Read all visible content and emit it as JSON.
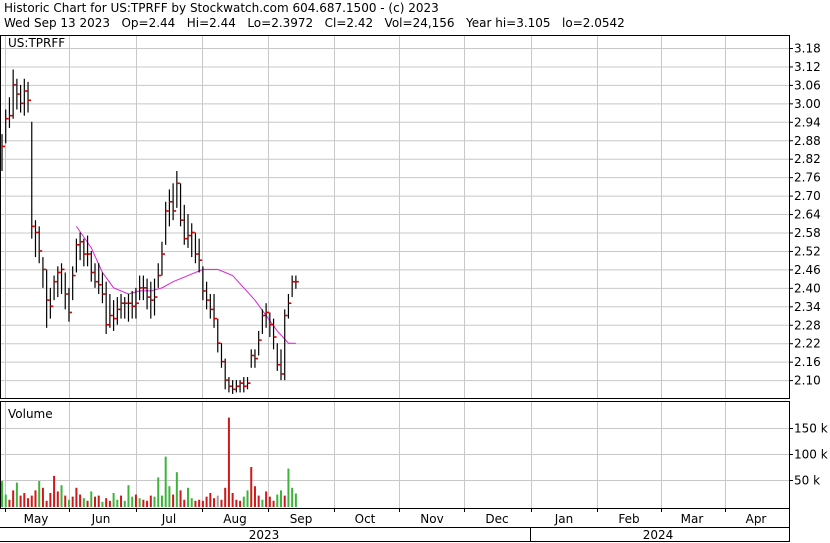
{
  "header": {
    "line1": "Historic Chart for US:TPRFF by Stockwatch.com 604.687.1500 - (c) 2023",
    "line2": "Wed Sep 13 2023   Op=2.44   Hi=2.44   Lo=2.3972   Cl=2.42   Vol=24,156   Year hi=3.105   lo=2.0542"
  },
  "price_panel": {
    "label": "US:TPRFF"
  },
  "volume_panel": {
    "label": "Volume"
  },
  "colors": {
    "grid": "#c8c8c8",
    "bar": "#000000",
    "close_tick": "#d00000",
    "moving_average": "#e020e0",
    "volume_up": "#3cb43c",
    "volume_down": "#d01818",
    "volume_flat": "#a0a0a0"
  },
  "chart_data": [
    {
      "type": "ohlc",
      "symbol": "US:TPRFF",
      "y_ticks": [
        "3.18",
        "3.12",
        "3.06",
        "3.00",
        "2.94",
        "2.88",
        "2.82",
        "2.76",
        "2.70",
        "2.64",
        "2.58",
        "2.52",
        "2.46",
        "2.40",
        "2.34",
        "2.28",
        "2.22",
        "2.16",
        "2.10"
      ],
      "ylim": [
        2.04,
        3.22
      ],
      "x_ticks": [
        "May",
        "Jun",
        "Jul",
        "Aug",
        "Sep",
        "Oct",
        "Nov",
        "Dec",
        "Jan",
        "Feb",
        "Mar",
        "Apr"
      ],
      "year_labels": [
        "2023",
        "2024"
      ],
      "x_range": [
        0,
        291
      ],
      "bars": [
        {
          "x": 0,
          "h": 2.9,
          "l": 2.78,
          "c": 2.86
        },
        {
          "x": 1,
          "h": 2.98,
          "l": 2.87,
          "c": 2.95
        },
        {
          "x": 2,
          "h": 3.02,
          "l": 2.92,
          "c": 2.96
        },
        {
          "x": 3,
          "h": 3.11,
          "l": 2.95,
          "c": 3.06
        },
        {
          "x": 4,
          "h": 3.08,
          "l": 2.98,
          "c": 3.03
        },
        {
          "x": 5,
          "h": 3.06,
          "l": 2.97,
          "c": 3.0
        },
        {
          "x": 6,
          "h": 3.08,
          "l": 2.96,
          "c": 3.04
        },
        {
          "x": 7,
          "h": 3.07,
          "l": 2.97,
          "c": 3.01
        },
        {
          "x": 8,
          "h": 2.94,
          "l": 2.56,
          "c": 2.6
        },
        {
          "x": 9,
          "h": 2.62,
          "l": 2.5,
          "c": 2.58
        },
        {
          "x": 10,
          "h": 2.6,
          "l": 2.48,
          "c": 2.52
        },
        {
          "x": 11,
          "h": 2.5,
          "l": 2.4,
          "c": 2.46
        },
        {
          "x": 12,
          "h": 2.46,
          "l": 2.27,
          "c": 2.36
        },
        {
          "x": 13,
          "h": 2.4,
          "l": 2.3,
          "c": 2.34
        },
        {
          "x": 14,
          "h": 2.44,
          "l": 2.36,
          "c": 2.42
        },
        {
          "x": 15,
          "h": 2.47,
          "l": 2.37,
          "c": 2.45
        },
        {
          "x": 16,
          "h": 2.48,
          "l": 2.38,
          "c": 2.46
        },
        {
          "x": 17,
          "h": 2.45,
          "l": 2.33,
          "c": 2.38
        },
        {
          "x": 18,
          "h": 2.4,
          "l": 2.29,
          "c": 2.32
        },
        {
          "x": 19,
          "h": 2.47,
          "l": 2.36,
          "c": 2.44
        },
        {
          "x": 20,
          "h": 2.56,
          "l": 2.45,
          "c": 2.54
        },
        {
          "x": 21,
          "h": 2.58,
          "l": 2.49,
          "c": 2.55
        },
        {
          "x": 22,
          "h": 2.56,
          "l": 2.47,
          "c": 2.51
        },
        {
          "x": 23,
          "h": 2.57,
          "l": 2.47,
          "c": 2.51
        },
        {
          "x": 24,
          "h": 2.52,
          "l": 2.42,
          "c": 2.45
        },
        {
          "x": 25,
          "h": 2.48,
          "l": 2.4,
          "c": 2.42
        },
        {
          "x": 26,
          "h": 2.48,
          "l": 2.38,
          "c": 2.41
        },
        {
          "x": 27,
          "h": 2.45,
          "l": 2.35,
          "c": 2.38
        },
        {
          "x": 28,
          "h": 2.42,
          "l": 2.25,
          "c": 2.28
        },
        {
          "x": 29,
          "h": 2.38,
          "l": 2.27,
          "c": 2.31
        },
        {
          "x": 30,
          "h": 2.36,
          "l": 2.26,
          "c": 2.3
        },
        {
          "x": 31,
          "h": 2.37,
          "l": 2.28,
          "c": 2.33
        },
        {
          "x": 32,
          "h": 2.38,
          "l": 2.3,
          "c": 2.35
        },
        {
          "x": 33,
          "h": 2.37,
          "l": 2.3,
          "c": 2.35
        },
        {
          "x": 34,
          "h": 2.38,
          "l": 2.29,
          "c": 2.35
        },
        {
          "x": 35,
          "h": 2.39,
          "l": 2.3,
          "c": 2.34
        },
        {
          "x": 36,
          "h": 2.4,
          "l": 2.3,
          "c": 2.35
        },
        {
          "x": 37,
          "h": 2.44,
          "l": 2.36,
          "c": 2.4
        },
        {
          "x": 38,
          "h": 2.44,
          "l": 2.36,
          "c": 2.4
        },
        {
          "x": 39,
          "h": 2.43,
          "l": 2.33,
          "c": 2.37
        },
        {
          "x": 40,
          "h": 2.42,
          "l": 2.3,
          "c": 2.36
        },
        {
          "x": 41,
          "h": 2.43,
          "l": 2.31,
          "c": 2.37
        },
        {
          "x": 42,
          "h": 2.48,
          "l": 2.4,
          "c": 2.44
        },
        {
          "x": 43,
          "h": 2.55,
          "l": 2.44,
          "c": 2.51
        },
        {
          "x": 44,
          "h": 2.68,
          "l": 2.54,
          "c": 2.65
        },
        {
          "x": 45,
          "h": 2.72,
          "l": 2.6,
          "c": 2.68
        },
        {
          "x": 46,
          "h": 2.74,
          "l": 2.62,
          "c": 2.65
        },
        {
          "x": 47,
          "h": 2.78,
          "l": 2.66,
          "c": 2.74
        },
        {
          "x": 48,
          "h": 2.74,
          "l": 2.6,
          "c": 2.62
        },
        {
          "x": 49,
          "h": 2.67,
          "l": 2.54,
          "c": 2.56
        },
        {
          "x": 50,
          "h": 2.64,
          "l": 2.53,
          "c": 2.57
        },
        {
          "x": 51,
          "h": 2.61,
          "l": 2.5,
          "c": 2.58
        },
        {
          "x": 52,
          "h": 2.58,
          "l": 2.48,
          "c": 2.51
        },
        {
          "x": 53,
          "h": 2.56,
          "l": 2.45,
          "c": 2.49
        },
        {
          "x": 54,
          "h": 2.47,
          "l": 2.36,
          "c": 2.39
        },
        {
          "x": 55,
          "h": 2.42,
          "l": 2.33,
          "c": 2.36
        },
        {
          "x": 56,
          "h": 2.38,
          "l": 2.3,
          "c": 2.33
        },
        {
          "x": 57,
          "h": 2.38,
          "l": 2.27,
          "c": 2.3
        },
        {
          "x": 58,
          "h": 2.3,
          "l": 2.19,
          "c": 2.22
        },
        {
          "x": 59,
          "h": 2.22,
          "l": 2.14,
          "c": 2.16
        },
        {
          "x": 60,
          "h": 2.17,
          "l": 2.07,
          "c": 2.1
        },
        {
          "x": 61,
          "h": 2.11,
          "l": 2.06,
          "c": 2.08
        },
        {
          "x": 62,
          "h": 2.1,
          "l": 2.055,
          "c": 2.07
        },
        {
          "x": 63,
          "h": 2.1,
          "l": 2.06,
          "c": 2.08
        },
        {
          "x": 64,
          "h": 2.1,
          "l": 2.06,
          "c": 2.09
        },
        {
          "x": 65,
          "h": 2.11,
          "l": 2.06,
          "c": 2.08
        },
        {
          "x": 66,
          "h": 2.11,
          "l": 2.07,
          "c": 2.09
        },
        {
          "x": 67,
          "h": 2.2,
          "l": 2.14,
          "c": 2.18
        },
        {
          "x": 68,
          "h": 2.2,
          "l": 2.14,
          "c": 2.17
        },
        {
          "x": 69,
          "h": 2.26,
          "l": 2.18,
          "c": 2.23
        },
        {
          "x": 70,
          "h": 2.33,
          "l": 2.25,
          "c": 2.31
        },
        {
          "x": 71,
          "h": 2.35,
          "l": 2.27,
          "c": 2.32
        },
        {
          "x": 72,
          "h": 2.32,
          "l": 2.24,
          "c": 2.28
        },
        {
          "x": 73,
          "h": 2.3,
          "l": 2.2,
          "c": 2.24
        },
        {
          "x": 74,
          "h": 2.22,
          "l": 2.13,
          "c": 2.15
        },
        {
          "x": 75,
          "h": 2.2,
          "l": 2.1,
          "c": 2.12
        },
        {
          "x": 76,
          "h": 2.33,
          "l": 2.1,
          "c": 2.31
        },
        {
          "x": 77,
          "h": 2.38,
          "l": 2.3,
          "c": 2.35
        },
        {
          "x": 78,
          "h": 2.44,
          "l": 2.37,
          "c": 2.42
        },
        {
          "x": 79,
          "h": 2.44,
          "l": 2.397,
          "c": 2.42
        }
      ],
      "moving_average": [
        {
          "x": 20,
          "y": 2.6
        },
        {
          "x": 24,
          "y": 2.53
        },
        {
          "x": 27,
          "y": 2.45
        },
        {
          "x": 30,
          "y": 2.4
        },
        {
          "x": 34,
          "y": 2.38
        },
        {
          "x": 37,
          "y": 2.39
        },
        {
          "x": 40,
          "y": 2.39
        },
        {
          "x": 43,
          "y": 2.4
        },
        {
          "x": 46,
          "y": 2.42
        },
        {
          "x": 50,
          "y": 2.44
        },
        {
          "x": 54,
          "y": 2.46
        },
        {
          "x": 58,
          "y": 2.46
        },
        {
          "x": 62,
          "y": 2.44
        },
        {
          "x": 65,
          "y": 2.4
        },
        {
          "x": 68,
          "y": 2.36
        },
        {
          "x": 71,
          "y": 2.31
        },
        {
          "x": 74,
          "y": 2.26
        },
        {
          "x": 77,
          "y": 2.22
        },
        {
          "x": 79,
          "y": 2.22
        }
      ]
    },
    {
      "type": "bar",
      "title": "Volume",
      "y_ticks": [
        "150 k",
        "100 k",
        "50 k"
      ],
      "ylim": [
        0,
        200
      ],
      "units": "thousand shares",
      "values": [
        {
          "x": 0,
          "v": 48,
          "d": "up"
        },
        {
          "x": 1,
          "v": 22,
          "d": "up"
        },
        {
          "x": 2,
          "v": 12,
          "d": "down"
        },
        {
          "x": 3,
          "v": 30,
          "d": "down"
        },
        {
          "x": 4,
          "v": 45,
          "d": "up"
        },
        {
          "x": 5,
          "v": 20,
          "d": "down"
        },
        {
          "x": 6,
          "v": 25,
          "d": "down"
        },
        {
          "x": 7,
          "v": 15,
          "d": "down"
        },
        {
          "x": 8,
          "v": 20,
          "d": "down"
        },
        {
          "x": 9,
          "v": 30,
          "d": "down"
        },
        {
          "x": 10,
          "v": 48,
          "d": "up"
        },
        {
          "x": 11,
          "v": 35,
          "d": "down"
        },
        {
          "x": 12,
          "v": 10,
          "d": "down"
        },
        {
          "x": 13,
          "v": 25,
          "d": "down"
        },
        {
          "x": 14,
          "v": 58,
          "d": "down"
        },
        {
          "x": 15,
          "v": 28,
          "d": "down"
        },
        {
          "x": 16,
          "v": 40,
          "d": "up"
        },
        {
          "x": 17,
          "v": 20,
          "d": "down"
        },
        {
          "x": 18,
          "v": 12,
          "d": "up"
        },
        {
          "x": 19,
          "v": 18,
          "d": "down"
        },
        {
          "x": 20,
          "v": 35,
          "d": "down"
        },
        {
          "x": 21,
          "v": 22,
          "d": "down"
        },
        {
          "x": 22,
          "v": 15,
          "d": "up"
        },
        {
          "x": 23,
          "v": 10,
          "d": "down"
        },
        {
          "x": 24,
          "v": 28,
          "d": "up"
        },
        {
          "x": 25,
          "v": 18,
          "d": "down"
        },
        {
          "x": 26,
          "v": 20,
          "d": "down"
        },
        {
          "x": 27,
          "v": 8,
          "d": "up"
        },
        {
          "x": 28,
          "v": 15,
          "d": "down"
        },
        {
          "x": 29,
          "v": 10,
          "d": "down"
        },
        {
          "x": 30,
          "v": 25,
          "d": "up"
        },
        {
          "x": 31,
          "v": 12,
          "d": "up"
        },
        {
          "x": 32,
          "v": 20,
          "d": "down"
        },
        {
          "x": 33,
          "v": 10,
          "d": "up"
        },
        {
          "x": 34,
          "v": 40,
          "d": "up"
        },
        {
          "x": 35,
          "v": 18,
          "d": "up"
        },
        {
          "x": 36,
          "v": 22,
          "d": "down"
        },
        {
          "x": 37,
          "v": 15,
          "d": "up"
        },
        {
          "x": 38,
          "v": 12,
          "d": "down"
        },
        {
          "x": 39,
          "v": 10,
          "d": "down"
        },
        {
          "x": 40,
          "v": 20,
          "d": "down"
        },
        {
          "x": 41,
          "v": 18,
          "d": "up"
        },
        {
          "x": 42,
          "v": 55,
          "d": "up"
        },
        {
          "x": 43,
          "v": 20,
          "d": "up"
        },
        {
          "x": 44,
          "v": 95,
          "d": "up"
        },
        {
          "x": 45,
          "v": 38,
          "d": "up"
        },
        {
          "x": 46,
          "v": 22,
          "d": "down"
        },
        {
          "x": 47,
          "v": 65,
          "d": "up"
        },
        {
          "x": 48,
          "v": 30,
          "d": "down"
        },
        {
          "x": 49,
          "v": 12,
          "d": "down"
        },
        {
          "x": 50,
          "v": 35,
          "d": "up"
        },
        {
          "x": 51,
          "v": 15,
          "d": "up"
        },
        {
          "x": 52,
          "v": 10,
          "d": "down"
        },
        {
          "x": 53,
          "v": 12,
          "d": "down"
        },
        {
          "x": 54,
          "v": 10,
          "d": "down"
        },
        {
          "x": 55,
          "v": 18,
          "d": "down"
        },
        {
          "x": 56,
          "v": 25,
          "d": "down"
        },
        {
          "x": 57,
          "v": 15,
          "d": "down"
        },
        {
          "x": 58,
          "v": 20,
          "d": "flat"
        },
        {
          "x": 59,
          "v": 12,
          "d": "down"
        },
        {
          "x": 60,
          "v": 35,
          "d": "down"
        },
        {
          "x": 61,
          "v": 170,
          "d": "down"
        },
        {
          "x": 62,
          "v": 25,
          "d": "down"
        },
        {
          "x": 63,
          "v": 12,
          "d": "down"
        },
        {
          "x": 64,
          "v": 10,
          "d": "down"
        },
        {
          "x": 65,
          "v": 18,
          "d": "up"
        },
        {
          "x": 66,
          "v": 30,
          "d": "up"
        },
        {
          "x": 67,
          "v": 75,
          "d": "down"
        },
        {
          "x": 68,
          "v": 38,
          "d": "down"
        },
        {
          "x": 69,
          "v": 20,
          "d": "down"
        },
        {
          "x": 70,
          "v": 12,
          "d": "up"
        },
        {
          "x": 71,
          "v": 28,
          "d": "down"
        },
        {
          "x": 72,
          "v": 18,
          "d": "down"
        },
        {
          "x": 73,
          "v": 10,
          "d": "down"
        },
        {
          "x": 74,
          "v": 22,
          "d": "up"
        },
        {
          "x": 75,
          "v": 30,
          "d": "up"
        },
        {
          "x": 76,
          "v": 20,
          "d": "down"
        },
        {
          "x": 77,
          "v": 72,
          "d": "up"
        },
        {
          "x": 78,
          "v": 35,
          "d": "up"
        },
        {
          "x": 79,
          "v": 24,
          "d": "up"
        }
      ]
    }
  ]
}
